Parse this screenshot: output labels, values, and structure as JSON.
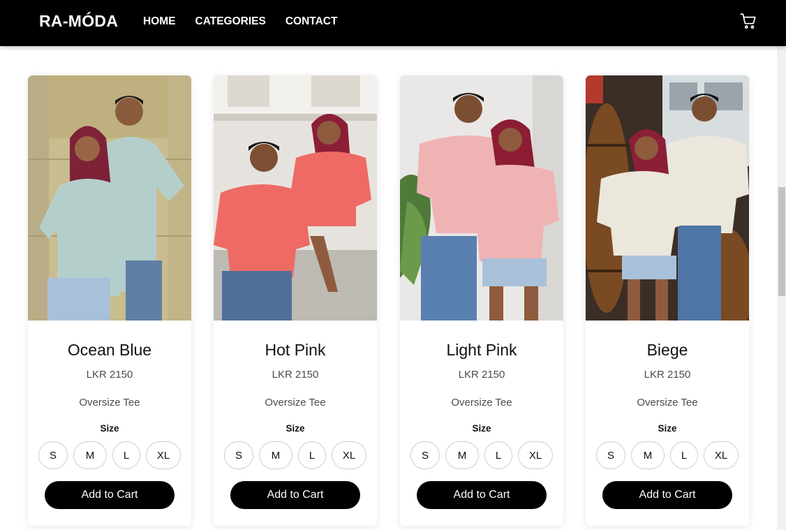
{
  "nav": {
    "brand": "RA-MÓDA",
    "links": [
      "HOME",
      "CATEGORIES",
      "CONTACT"
    ],
    "cart_icon": "shopping-cart-icon"
  },
  "products": [
    {
      "name": "Ocean Blue",
      "price": "LKR 2150",
      "type": "Oversize Tee",
      "size_label": "Size",
      "sizes": [
        "S",
        "M",
        "L",
        "XL"
      ],
      "button": "Add to Cart",
      "shirt_color": "#b4cfcb"
    },
    {
      "name": "Hot Pink",
      "price": "LKR 2150",
      "type": "Oversize Tee",
      "size_label": "Size",
      "sizes": [
        "S",
        "M",
        "L",
        "XL"
      ],
      "button": "Add to Cart",
      "shirt_color": "#ef6a64"
    },
    {
      "name": "Light Pink",
      "price": "LKR 2150",
      "type": "Oversize Tee",
      "size_label": "Size",
      "sizes": [
        "S",
        "M",
        "L",
        "XL"
      ],
      "button": "Add to Cart",
      "shirt_color": "#efb3b4"
    },
    {
      "name": "Biege",
      "price": "LKR 2150",
      "type": "Oversize Tee",
      "size_label": "Size",
      "sizes": [
        "S",
        "M",
        "L",
        "XL"
      ],
      "button": "Add to Cart",
      "shirt_color": "#ece7dc"
    }
  ],
  "colors": {
    "navbar": "#000000",
    "button": "#000000",
    "text": "#111111",
    "muted": "#4b4b4b"
  }
}
